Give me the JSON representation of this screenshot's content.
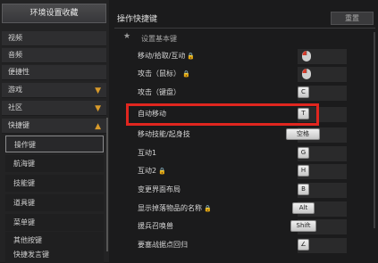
{
  "sidebar": {
    "header": "环境设置收藏",
    "items": [
      {
        "label": "视频"
      },
      {
        "label": "音频"
      },
      {
        "label": "便捷性"
      },
      {
        "label": "游戏",
        "chevron": "down"
      },
      {
        "label": "社区",
        "chevron": "down"
      },
      {
        "label": "快捷键",
        "chevron": "up"
      }
    ],
    "subitems": [
      {
        "label": "操作键",
        "active": true
      },
      {
        "label": "航海键"
      },
      {
        "label": "技能键"
      },
      {
        "label": "道具键"
      },
      {
        "label": "菜单键"
      },
      {
        "label": "其他按键"
      },
      {
        "label": "快捷发言键"
      }
    ]
  },
  "main": {
    "title": "操作快捷键",
    "reset_label": "重置",
    "section_title": "设置基本键",
    "rows": [
      {
        "label": "移动/拾取/互动",
        "lock": true,
        "key_type": "mouse"
      },
      {
        "label": "攻击（鼠标）",
        "lock": true,
        "key_type": "mouse"
      },
      {
        "label": "攻击（键盘）",
        "key": "C"
      },
      {
        "label": "自动移动",
        "key": "T",
        "highlight": true
      },
      {
        "label": "移动技能/起身技",
        "key": "空格",
        "wide": true
      },
      {
        "label": "互动1",
        "key": "G"
      },
      {
        "label": "互动2",
        "lock": true,
        "key": "H"
      },
      {
        "label": "变更界面布局",
        "key": "B"
      },
      {
        "label": "显示掉落物品的名称",
        "lock": true,
        "key": "Alt",
        "wide": true
      },
      {
        "label": "援兵召唤兽",
        "key": "Shift",
        "wide": true
      },
      {
        "label": "要塞战据点回归",
        "key": "∠"
      }
    ]
  },
  "colors": {
    "highlight": "#e0261f",
    "accent": "#d89a2a"
  }
}
